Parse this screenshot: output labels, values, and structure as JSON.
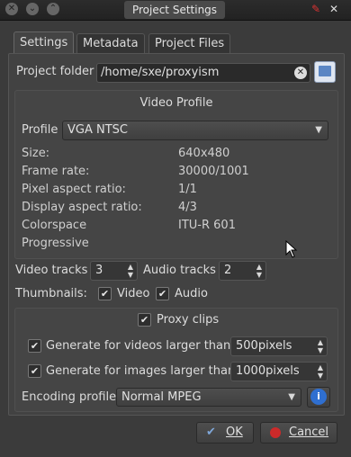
{
  "window": {
    "title": "Project Settings",
    "titlebar_right_icons": [
      "pin-icon",
      "close-icon"
    ]
  },
  "tabs": [
    {
      "label": "Settings",
      "active": true
    },
    {
      "label": "Metadata",
      "active": false
    },
    {
      "label": "Project Files",
      "active": false
    }
  ],
  "project_folder": {
    "label": "Project folder",
    "value": "/home/sxe/proxyism",
    "clear_icon": "clear-text-icon",
    "browse_icon": "folder-open-icon"
  },
  "video_profile": {
    "title": "Video Profile",
    "profile_label": "Profile",
    "profile_value": "VGA NTSC",
    "properties": [
      {
        "name": "Size:",
        "value": "640x480"
      },
      {
        "name": "Frame rate:",
        "value": "30000/1001"
      },
      {
        "name": "Pixel aspect ratio:",
        "value": "1/1"
      },
      {
        "name": "Display aspect ratio:",
        "value": "4/3"
      },
      {
        "name": "Colorspace",
        "value": "ITU-R 601"
      },
      {
        "name": "Progressive",
        "value": ""
      }
    ]
  },
  "tracks": {
    "video_label": "Video tracks",
    "video_value": "3",
    "audio_label": "Audio tracks",
    "audio_value": "2"
  },
  "thumbnails": {
    "label": "Thumbnails:",
    "video_label": "Video",
    "video_checked": true,
    "audio_label": "Audio",
    "audio_checked": true
  },
  "proxy": {
    "proxy_label": "Proxy clips",
    "proxy_checked": true,
    "videos_label": "Generate for videos larger than",
    "videos_checked": true,
    "videos_value": "500pixels",
    "images_label": "Generate for images larger than",
    "images_checked": true,
    "images_value": "1000pixels",
    "encoding_label": "Encoding profile",
    "encoding_value": "Normal MPEG"
  },
  "buttons": {
    "ok_label": "OK",
    "cancel_label": "Cancel"
  },
  "colors": {
    "accent": "#2f6fd0",
    "cancel_icon": "#cc2a2a",
    "ok_icon": "#7fa7d9"
  }
}
